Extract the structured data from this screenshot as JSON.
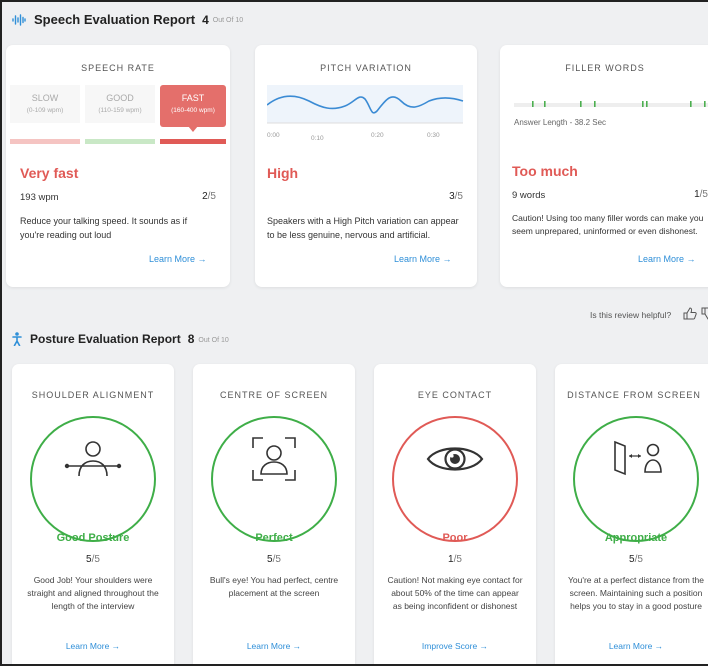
{
  "speech": {
    "title": "Speech Evaluation Report",
    "score": "4",
    "out_of": "Out Of 10",
    "icon": "audio-wave-icon"
  },
  "speech_rate": {
    "title": "SPEECH RATE",
    "options": [
      {
        "label": "SLOW",
        "range": "(0-109 wpm)"
      },
      {
        "label": "GOOD",
        "range": "(110-159 wpm)"
      },
      {
        "label": "FAST",
        "range": "(160-400 wpm)"
      }
    ],
    "verdict": "Very fast",
    "value": "193 wpm",
    "score": "2",
    "score_den": "/5",
    "desc": "Reduce your talking speed. It sounds as if you're reading out loud",
    "link": "Learn More →"
  },
  "pitch": {
    "title": "PITCH VARIATION",
    "ticks": [
      "0:00",
      "0:10",
      "0:20",
      "0:30"
    ],
    "verdict": "High",
    "score": "3",
    "score_den": "/5",
    "desc": "Speakers with a High Pitch variation can appear to be less genuine, nervous and artificial.",
    "link": "Learn More →"
  },
  "filler": {
    "title": "FILLER WORDS",
    "answer_length": "Answer Length - 38.2 Sec",
    "verdict": "Too much",
    "value": "9 words",
    "score": "1",
    "score_den": "/5",
    "desc": "Caution! Using too many filler words can make you seem unprepared, uninformed or even dishonest.",
    "link": "Learn More →"
  },
  "feedback": {
    "question": "Is this review helpful?",
    "thumbs_up": "thumbs-up-icon",
    "thumbs_down": "thumbs-down-icon"
  },
  "posture": {
    "title": "Posture Evaluation Report",
    "score": "8",
    "out_of": "Out Of 10",
    "icon": "person-icon",
    "cards": [
      {
        "title": "SHOULDER ALIGNMENT",
        "verdict": "Good Posture",
        "score": "5",
        "den": "/5",
        "desc": "Good Job! Your shoulders were straight and aligned throughout the length of the interview",
        "link": "Learn More →"
      },
      {
        "title": "CENTRE OF SCREEN",
        "verdict": "Perfect",
        "score": "5",
        "den": "/5",
        "desc": "Bull's eye! You had perfect, centre placement at the screen",
        "link": "Learn More →"
      },
      {
        "title": "EYE CONTACT",
        "verdict": "Poor",
        "score": "1",
        "den": "/5",
        "desc": "Caution! Not making eye contact for about 50% of the time can appear as being inconfident or dishonest",
        "link": "Improve Score →"
      },
      {
        "title": "DISTANCE FROM SCREEN",
        "verdict": "Appropriate",
        "score": "5",
        "den": "/5",
        "desc": "You're at a perfect distance from the screen. Maintaining such a position helps you to stay in a good posture",
        "link": "Learn More →"
      }
    ]
  },
  "colors": {
    "good": "#3fae48",
    "bad": "#e05a56",
    "link": "#2f8fd8"
  }
}
